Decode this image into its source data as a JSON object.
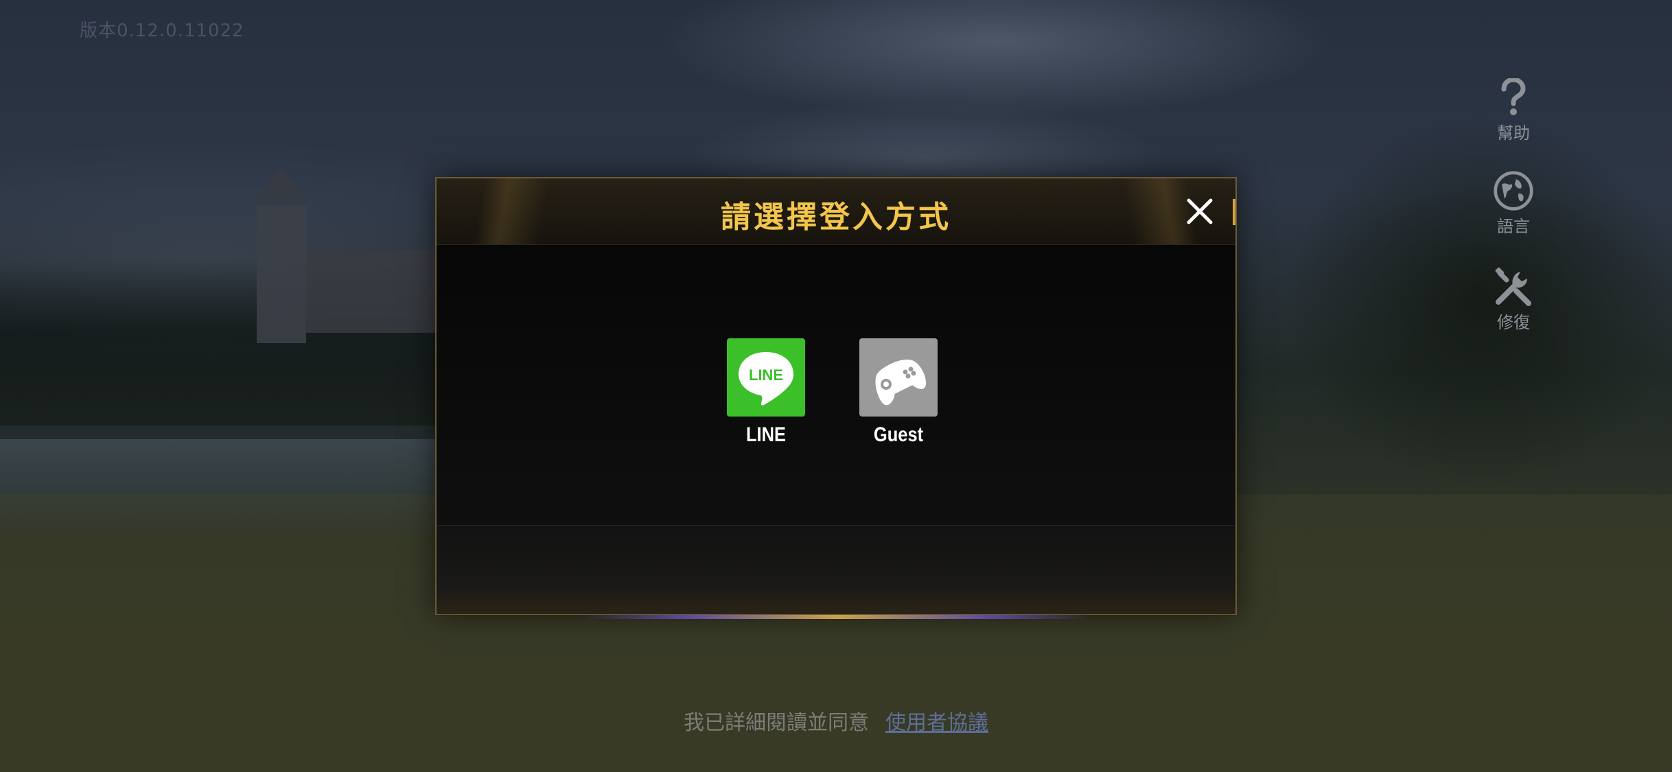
{
  "version": {
    "text": "版本0.12.0.11022"
  },
  "side_tools": [
    {
      "label": "幫助",
      "icon": "help-icon"
    },
    {
      "label": "語言",
      "icon": "globe-icon"
    },
    {
      "label": "修復",
      "icon": "repair-icon"
    }
  ],
  "dialog": {
    "title": "請選擇登入方式",
    "close_icon": "close-icon",
    "options": [
      {
        "label": "LINE",
        "icon": "line-icon",
        "color": "#3cc02a"
      },
      {
        "label": "Guest",
        "icon": "gamepad-icon",
        "color": "#9a9a9a"
      }
    ],
    "accent_color": "#f2c64a"
  },
  "agreement": {
    "text": "我已詳細閱讀並同意",
    "link": "使用者協議"
  }
}
